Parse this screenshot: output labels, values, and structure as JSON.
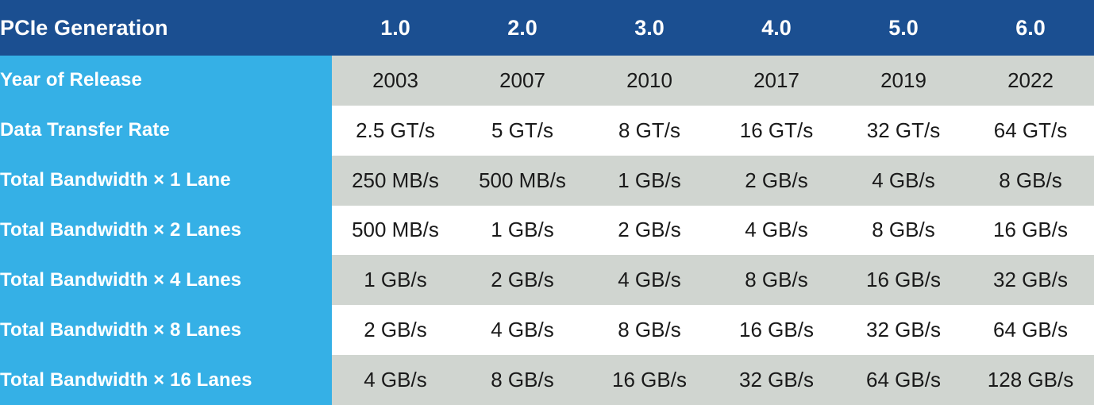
{
  "theme": {
    "header_bg": "#1b4f91",
    "label_bg": "#35b0e6",
    "shaded_row_bg": "#d0d5d0",
    "plain_row_bg": "#ffffff",
    "header_text": "#ffffff",
    "label_text": "#ffffff",
    "value_text": "#1a1a1a"
  },
  "table": {
    "corner_label": "PCIe Generation",
    "columns": [
      "1.0",
      "2.0",
      "3.0",
      "4.0",
      "5.0",
      "6.0"
    ],
    "rows": [
      {
        "label": "Year of Release",
        "shaded": true,
        "values": [
          "2003",
          "2007",
          "2010",
          "2017",
          "2019",
          "2022"
        ]
      },
      {
        "label": "Data Transfer Rate",
        "shaded": false,
        "values": [
          "2.5 GT/s",
          "5 GT/s",
          "8 GT/s",
          "16 GT/s",
          "32 GT/s",
          "64 GT/s"
        ]
      },
      {
        "label": "Total Bandwidth × 1 Lane",
        "shaded": true,
        "values": [
          "250 MB/s",
          "500 MB/s",
          "1 GB/s",
          "2 GB/s",
          "4 GB/s",
          "8 GB/s"
        ]
      },
      {
        "label": "Total Bandwidth × 2 Lanes",
        "shaded": false,
        "values": [
          "500 MB/s",
          "1 GB/s",
          "2 GB/s",
          "4 GB/s",
          "8 GB/s",
          "16 GB/s"
        ]
      },
      {
        "label": "Total Bandwidth × 4 Lanes",
        "shaded": true,
        "values": [
          "1 GB/s",
          "2 GB/s",
          "4 GB/s",
          "8 GB/s",
          "16 GB/s",
          "32 GB/s"
        ]
      },
      {
        "label": "Total Bandwidth × 8 Lanes",
        "shaded": false,
        "values": [
          "2 GB/s",
          "4 GB/s",
          "8 GB/s",
          "16 GB/s",
          "32 GB/s",
          "64 GB/s"
        ]
      },
      {
        "label": "Total Bandwidth × 16 Lanes",
        "shaded": true,
        "values": [
          "4 GB/s",
          "8 GB/s",
          "16 GB/s",
          "32 GB/s",
          "64 GB/s",
          "128 GB/s"
        ]
      }
    ]
  }
}
